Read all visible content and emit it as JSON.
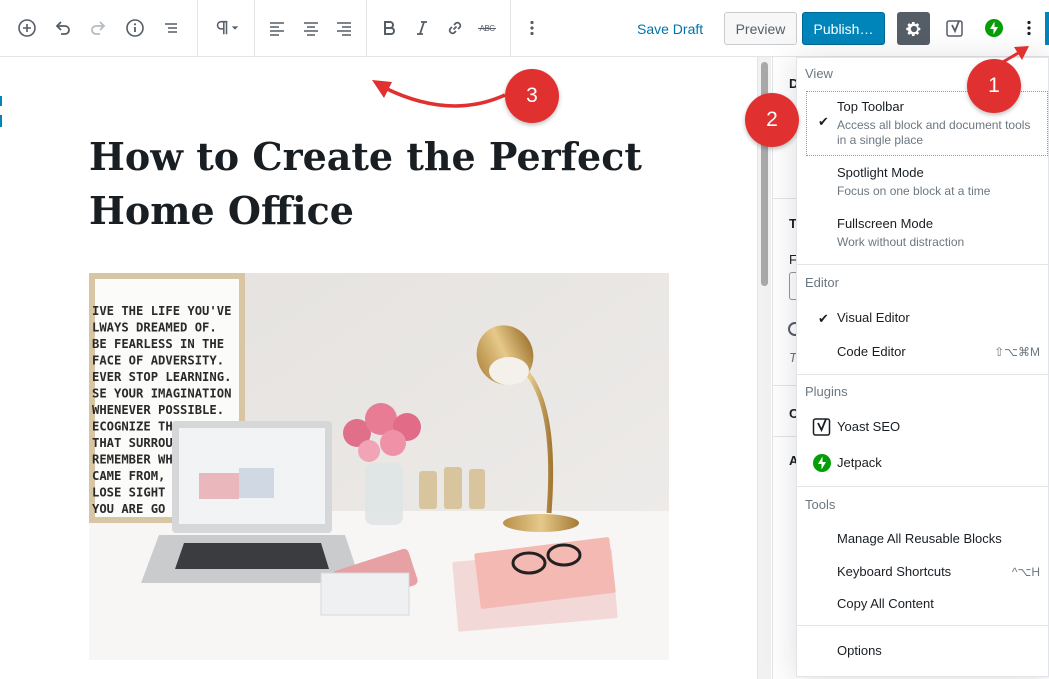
{
  "toolbar": {
    "save_draft": "Save Draft",
    "preview": "Preview",
    "publish": "Publish…",
    "icons": [
      "add-block-icon",
      "undo-icon",
      "redo-icon",
      "info-icon",
      "outline-icon",
      "paragraph-icon",
      "align-left-icon",
      "align-center-icon",
      "align-right-icon",
      "bold-icon",
      "italic-icon",
      "link-icon",
      "strikethrough-icon",
      "more-vertical-icon",
      "gear-icon",
      "yoast-icon",
      "jetpack-icon"
    ],
    "strikethrough_glyph": "ABC",
    "colors": {
      "primary": "#0085ba",
      "link": "#0073aa",
      "settings_bg": "#555d66",
      "jetpack_green": "#069e08",
      "annotation_red": "#e03130"
    }
  },
  "post": {
    "title": "How to Create the Perfect Home Office",
    "image_poster_text": "IVE THE LIFE YOU'VE\nLWAYS DREAMED OF.\nBE FEARLESS IN THE\nFACE OF ADVERSITY.\nEVER STOP LEARNING.\nSE YOUR IMAGINATION\nWHENEVER POSSIBLE.\nECOGNIZE THE  AUTY\nTHAT SURROUN\nREMEMBER WHI\nCAME FROM, BU\nLOSE SIGHT OF\nYOU ARE GO"
  },
  "sidebar": {
    "letters": [
      "D",
      "T",
      "F",
      "T",
      "C",
      "A"
    ]
  },
  "menu": {
    "view": {
      "label": "View",
      "items": [
        {
          "label": "Top Toolbar",
          "desc": "Access all block and document tools in a single place",
          "checked": "✔"
        },
        {
          "label": "Spotlight Mode",
          "desc": "Focus on one block at a time"
        },
        {
          "label": "Fullscreen Mode",
          "desc": "Work without distraction"
        }
      ]
    },
    "editor": {
      "label": "Editor",
      "items": [
        {
          "label": "Visual Editor",
          "checked": "✔"
        },
        {
          "label": "Code Editor",
          "shortcut": "⇧⌥⌘M"
        }
      ]
    },
    "plugins": {
      "label": "Plugins",
      "items": [
        {
          "label": "Yoast SEO",
          "icon": "yoast-icon"
        },
        {
          "label": "Jetpack",
          "icon": "jetpack-icon"
        }
      ]
    },
    "tools": {
      "label": "Tools",
      "items": [
        {
          "label": "Manage All Reusable Blocks"
        },
        {
          "label": "Keyboard Shortcuts",
          "shortcut": "^⌥H"
        },
        {
          "label": "Copy All Content"
        }
      ]
    },
    "options": {
      "label": "Options"
    }
  },
  "annotations": {
    "badge1": "1",
    "badge2": "2",
    "badge3": "3"
  }
}
